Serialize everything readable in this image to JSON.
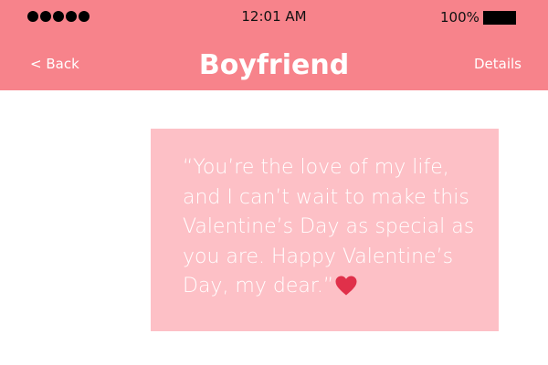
{
  "status_bar": {
    "signal_dots": 5,
    "time": "12:01 AM",
    "battery_percent": "100%"
  },
  "nav": {
    "back_label": "< Back",
    "title": "Boyfriend",
    "details_label": "Details"
  },
  "message": {
    "lines": [
      "“You’re the love of my life,",
      "and I can’t wait to make this",
      "Valentine’s Day as special as",
      "you are. Happy Valentine’s",
      "Day, my dear.”"
    ],
    "emoji": "heart-icon"
  },
  "colors": {
    "header": "#f7838b",
    "bubble": "#fdc0c6",
    "heart": "#e0304a"
  }
}
